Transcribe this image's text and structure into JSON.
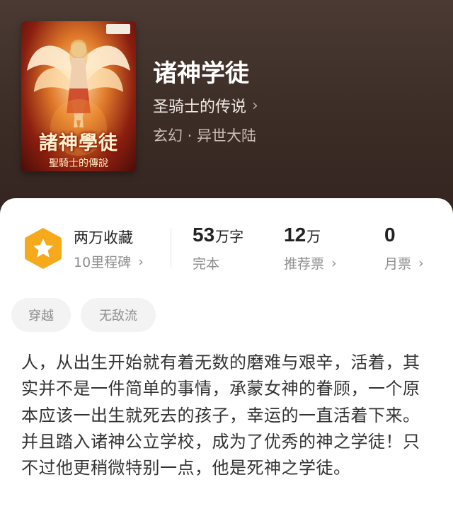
{
  "book": {
    "title": "诸神学徒",
    "series": "圣骑士的传说",
    "genre": "玄幻 · 异世大陆",
    "cover_title": "諸神學徒",
    "cover_subtitle": "聖騎士的傳說"
  },
  "stats": {
    "collection_title": "两万收藏",
    "collection_sub": "10里程碑",
    "words_value": "53",
    "words_unit": "万字",
    "words_sub": "完本",
    "recommend_value": "12",
    "recommend_unit": "万",
    "recommend_sub": "推荐票",
    "monthly_value": "0",
    "monthly_sub": "月票"
  },
  "tags": [
    "穿越",
    "无敌流"
  ],
  "description": "人，从出生开始就有着无数的磨难与艰辛，活着，其实并不是一件简单的事情，承蒙女神的眷顾，一个原本应该一出生就死去的孩子，幸运的一直活着下来。并且踏入诸神公立学校，成为了优秀的神之学徒！只不过他更稍微特别一点，他是死神之学徒。",
  "icons": {
    "series_chevron": "chevron-right-icon",
    "badge": "star-hexagon-icon"
  },
  "colors": {
    "hero_bg": "#3c2d27",
    "badge": "#f7a91c",
    "text_primary": "#333333",
    "text_secondary": "#8e8e8e"
  }
}
